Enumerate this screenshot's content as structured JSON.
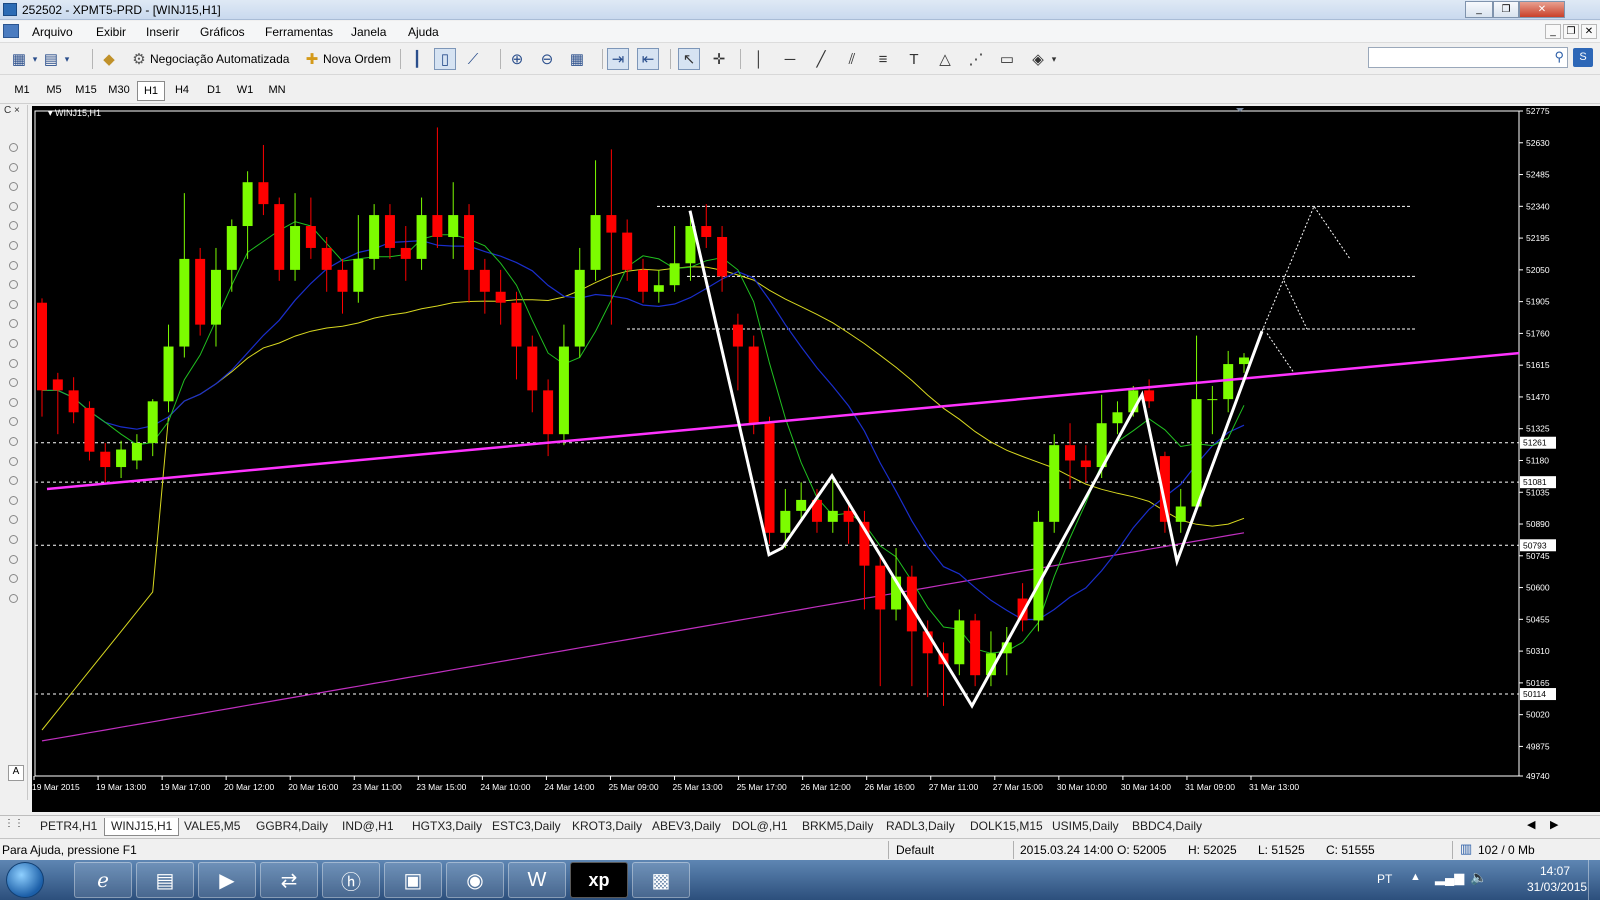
{
  "window": {
    "title": "252502 - XPMT5-PRD - [WINJ15,H1]",
    "minimize": "_",
    "restore": "❐",
    "close": "✕"
  },
  "menu": [
    "Arquivo",
    "Exibir",
    "Inserir",
    "Gráficos",
    "Ferramentas",
    "Janela",
    "Ajuda"
  ],
  "toolbar": {
    "auto_trading": "Negociação Automatizada",
    "new_order": "Nova Ordem"
  },
  "search": {
    "placeholder": ""
  },
  "timeframes": [
    "M1",
    "M5",
    "M15",
    "M30",
    "H1",
    "H4",
    "D1",
    "W1",
    "MN"
  ],
  "active_timeframe": "H1",
  "chart": {
    "label": "WINJ15,H1",
    "bg": "#000000",
    "up_color": "#7cfc00",
    "down_color": "#ff0000",
    "grid_color": "#ffffff",
    "price_axis": [
      "52775",
      "52630",
      "52485",
      "52340",
      "52195",
      "52050",
      "51905",
      "51760",
      "51615",
      "51470",
      "51325",
      "51180",
      "51035",
      "50890",
      "50745",
      "50600",
      "50455",
      "50310",
      "50165",
      "50020",
      "49875",
      "49740"
    ],
    "price_marks": [
      "51261",
      "51081",
      "50793",
      "50114"
    ],
    "time_axis": [
      "19 Mar 2015",
      "19 Mar 13:00",
      "19 Mar 17:00",
      "20 Mar 12:00",
      "20 Mar 16:00",
      "23 Mar 11:00",
      "23 Mar 15:00",
      "24 Mar 10:00",
      "24 Mar 14:00",
      "25 Mar 09:00",
      "25 Mar 13:00",
      "25 Mar 17:00",
      "26 Mar 12:00",
      "26 Mar 16:00",
      "27 Mar 11:00",
      "27 Mar 15:00",
      "30 Mar 10:00",
      "30 Mar 14:00",
      "31 Mar 09:00",
      "31 Mar 13:00"
    ],
    "auto_label": "A"
  },
  "chart_data": {
    "type": "candlestick",
    "symbol": "WINJ15",
    "timeframe": "H1",
    "ylim": [
      49740,
      52775
    ],
    "horizontal_levels": [
      51261,
      51081,
      50793,
      50114
    ],
    "candles": [
      {
        "o": 51900,
        "c": 51500,
        "h": 51920,
        "l": 51380
      },
      {
        "o": 51550,
        "c": 51500,
        "h": 51580,
        "l": 51300
      },
      {
        "o": 51500,
        "c": 51400,
        "h": 51560,
        "l": 51350
      },
      {
        "o": 51420,
        "c": 51220,
        "h": 51450,
        "l": 51180
      },
      {
        "o": 51220,
        "c": 51150,
        "h": 51260,
        "l": 51080
      },
      {
        "o": 51150,
        "c": 51230,
        "h": 51270,
        "l": 51100
      },
      {
        "o": 51180,
        "c": 51260,
        "h": 51300,
        "l": 51140
      },
      {
        "o": 51260,
        "c": 51450,
        "h": 51460,
        "l": 51200
      },
      {
        "o": 51450,
        "c": 51700,
        "h": 51800,
        "l": 51400
      },
      {
        "o": 51700,
        "c": 52100,
        "h": 52400,
        "l": 51650
      },
      {
        "o": 52100,
        "c": 51800,
        "h": 52150,
        "l": 51750
      },
      {
        "o": 51800,
        "c": 52050,
        "h": 52150,
        "l": 51700
      },
      {
        "o": 52050,
        "c": 52250,
        "h": 52280,
        "l": 51950
      },
      {
        "o": 52250,
        "c": 52450,
        "h": 52500,
        "l": 52100
      },
      {
        "o": 52450,
        "c": 52350,
        "h": 52620,
        "l": 52300
      },
      {
        "o": 52350,
        "c": 52050,
        "h": 52380,
        "l": 52000
      },
      {
        "o": 52050,
        "c": 52250,
        "h": 52400,
        "l": 52000
      },
      {
        "o": 52250,
        "c": 52150,
        "h": 52380,
        "l": 52100
      },
      {
        "o": 52150,
        "c": 52050,
        "h": 52200,
        "l": 51950
      },
      {
        "o": 52050,
        "c": 51950,
        "h": 52100,
        "l": 51850
      },
      {
        "o": 51950,
        "c": 52100,
        "h": 52300,
        "l": 51900
      },
      {
        "o": 52100,
        "c": 52300,
        "h": 52350,
        "l": 52050
      },
      {
        "o": 52300,
        "c": 52150,
        "h": 52350,
        "l": 52100
      },
      {
        "o": 52150,
        "c": 52100,
        "h": 52250,
        "l": 52000
      },
      {
        "o": 52100,
        "c": 52300,
        "h": 52380,
        "l": 52050
      },
      {
        "o": 52300,
        "c": 52200,
        "h": 52700,
        "l": 52150
      },
      {
        "o": 52200,
        "c": 52300,
        "h": 52450,
        "l": 52100
      },
      {
        "o": 52300,
        "c": 52050,
        "h": 52350,
        "l": 51900
      },
      {
        "o": 52050,
        "c": 51950,
        "h": 52100,
        "l": 51850
      },
      {
        "o": 51950,
        "c": 51900,
        "h": 52050,
        "l": 51800
      },
      {
        "o": 51900,
        "c": 51700,
        "h": 51950,
        "l": 51550
      },
      {
        "o": 51700,
        "c": 51500,
        "h": 51750,
        "l": 51400
      },
      {
        "o": 51500,
        "c": 51300,
        "h": 51550,
        "l": 51200
      },
      {
        "o": 51300,
        "c": 51700,
        "h": 51800,
        "l": 51250
      },
      {
        "o": 51700,
        "c": 52050,
        "h": 52150,
        "l": 51650
      },
      {
        "o": 52050,
        "c": 52300,
        "h": 52550,
        "l": 52000
      },
      {
        "o": 52300,
        "c": 52220,
        "h": 52600,
        "l": 51800
      },
      {
        "o": 52220,
        "c": 52050,
        "h": 52280,
        "l": 52000
      },
      {
        "o": 52050,
        "c": 51950,
        "h": 52100,
        "l": 51900
      },
      {
        "o": 51950,
        "c": 51980,
        "h": 52050,
        "l": 51900
      },
      {
        "o": 51980,
        "c": 52080,
        "h": 52250,
        "l": 51950
      },
      {
        "o": 52080,
        "c": 52250,
        "h": 52300,
        "l": 52000
      },
      {
        "o": 52250,
        "c": 52200,
        "h": 52350,
        "l": 52150
      },
      {
        "o": 52200,
        "c": 52020,
        "h": 52250,
        "l": 51950
      },
      {
        "o": 51800,
        "c": 51700,
        "h": 51850,
        "l": 51500
      },
      {
        "o": 51700,
        "c": 51350,
        "h": 51750,
        "l": 51300
      },
      {
        "o": 51350,
        "c": 50850,
        "h": 51380,
        "l": 50800
      },
      {
        "o": 50850,
        "c": 50950,
        "h": 51050,
        "l": 50780
      },
      {
        "o": 50950,
        "c": 51000,
        "h": 51080,
        "l": 50900
      },
      {
        "o": 51000,
        "c": 50900,
        "h": 51050,
        "l": 50850
      },
      {
        "o": 50900,
        "c": 50950,
        "h": 51100,
        "l": 50850
      },
      {
        "o": 50950,
        "c": 50900,
        "h": 51000,
        "l": 50800
      },
      {
        "o": 50900,
        "c": 50700,
        "h": 50950,
        "l": 50500
      },
      {
        "o": 50700,
        "c": 50500,
        "h": 50750,
        "l": 50150
      },
      {
        "o": 50500,
        "c": 50650,
        "h": 50780,
        "l": 50450
      },
      {
        "o": 50650,
        "c": 50400,
        "h": 50700,
        "l": 50150
      },
      {
        "o": 50400,
        "c": 50300,
        "h": 50450,
        "l": 50100
      },
      {
        "o": 50300,
        "c": 50250,
        "h": 50350,
        "l": 50060
      },
      {
        "o": 50250,
        "c": 50450,
        "h": 50500,
        "l": 50200
      },
      {
        "o": 50450,
        "c": 50200,
        "h": 50480,
        "l": 50150
      },
      {
        "o": 50200,
        "c": 50300,
        "h": 50400,
        "l": 50150
      },
      {
        "o": 50300,
        "c": 50350,
        "h": 50420,
        "l": 50200
      },
      {
        "o": 50550,
        "c": 50450,
        "h": 50620,
        "l": 50400
      },
      {
        "o": 50450,
        "c": 50900,
        "h": 50950,
        "l": 50400
      },
      {
        "o": 50900,
        "c": 51250,
        "h": 51300,
        "l": 50850
      },
      {
        "o": 51250,
        "c": 51180,
        "h": 51350,
        "l": 51050
      },
      {
        "o": 51180,
        "c": 51150,
        "h": 51250,
        "l": 51080
      },
      {
        "o": 51150,
        "c": 51350,
        "h": 51480,
        "l": 51100
      },
      {
        "o": 51350,
        "c": 51400,
        "h": 51450,
        "l": 51300
      },
      {
        "o": 51400,
        "c": 51500,
        "h": 51520,
        "l": 51380
      },
      {
        "o": 51500,
        "c": 51450,
        "h": 51550,
        "l": 51420
      },
      {
        "o": 51200,
        "c": 50900,
        "h": 51220,
        "l": 50850
      },
      {
        "o": 50900,
        "c": 50970,
        "h": 51050,
        "l": 50850
      },
      {
        "o": 50970,
        "c": 51460,
        "h": 51750,
        "l": 50950
      },
      {
        "o": 51460,
        "c": 51460,
        "h": 51520,
        "l": 51300
      },
      {
        "o": 51460,
        "c": 51620,
        "h": 51680,
        "l": 51400
      },
      {
        "o": 51620,
        "c": 51650,
        "h": 51670,
        "l": 51580
      }
    ]
  },
  "symbol_tabs": [
    "PETR4,H1",
    "WINJ15,H1",
    "VALE5,M5",
    "GGBR4,Daily",
    "IND@,H1",
    "HGTX3,Daily",
    "ESTC3,Daily",
    "KROT3,Daily",
    "ABEV3,Daily",
    "DOL@,H1",
    "BRKM5,Daily",
    "RADL3,Daily",
    "DOLK15,M15",
    "USIM5,Daily",
    "BBDC4,Daily"
  ],
  "active_symbol_tab": "WINJ15,H1",
  "status": {
    "help": "Para Ajuda, pressione F1",
    "profile": "Default",
    "datetime": "2015.03.24 14:00",
    "open": "O: 52005",
    "high": "H: 52025",
    "low": "L: 51525",
    "close": "C: 51555",
    "traffic": "102 / 0 Mb"
  },
  "taskbar": {
    "lang": "PT",
    "time": "14:07",
    "date": "31/03/2015",
    "apps": [
      "internet-explorer",
      "file-explorer",
      "media-player",
      "network-app",
      "hp-app",
      "archive-app",
      "chrome",
      "word",
      "xp-trader",
      "photo-app"
    ],
    "xp_label": "xp"
  }
}
